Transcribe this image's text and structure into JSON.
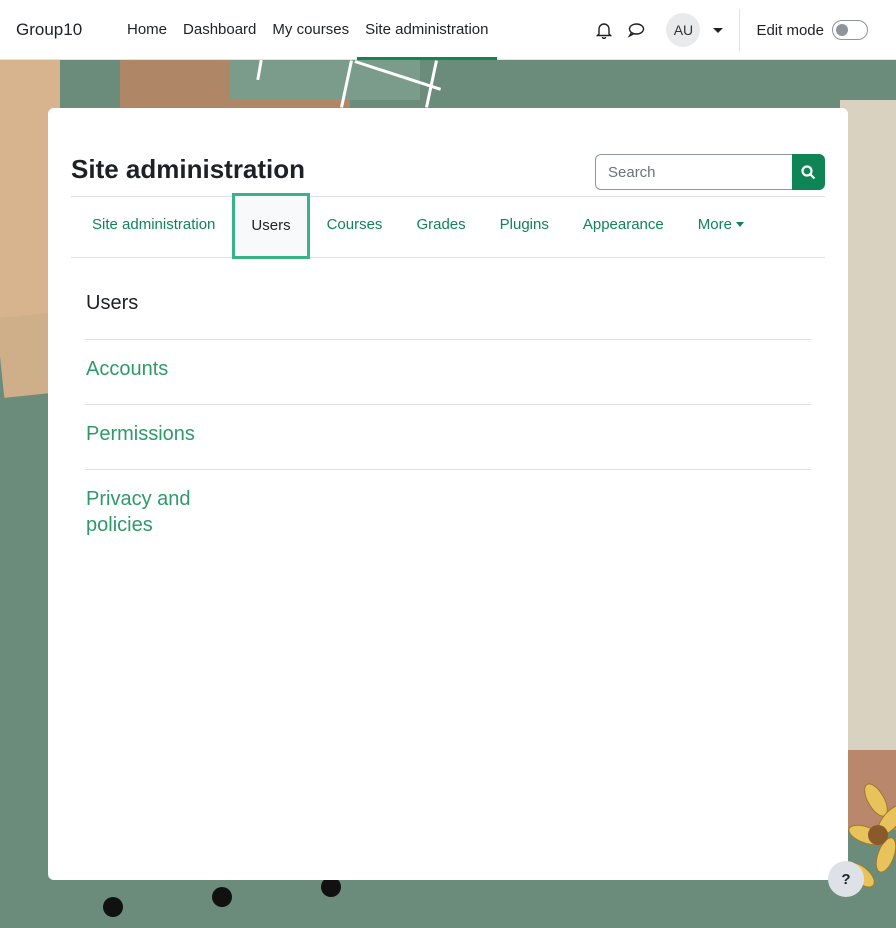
{
  "navbar": {
    "brand": "Group10",
    "links": [
      "Home",
      "Dashboard",
      "My courses",
      "Site administration"
    ],
    "active_link": "Site administration",
    "avatar_initials": "AU",
    "edit_mode_label": "Edit mode",
    "edit_mode_on": false
  },
  "page": {
    "title": "Site administration",
    "search_placeholder": "Search",
    "accent_color": "#0f8556"
  },
  "tabs": {
    "items": [
      "Site administration",
      "Users",
      "Courses",
      "Grades",
      "Plugins",
      "Appearance",
      "More"
    ],
    "active": "Users"
  },
  "sections": {
    "heading": "Users",
    "links": [
      "Accounts",
      "Permissions",
      "Privacy and policies"
    ]
  },
  "help_button": "?"
}
